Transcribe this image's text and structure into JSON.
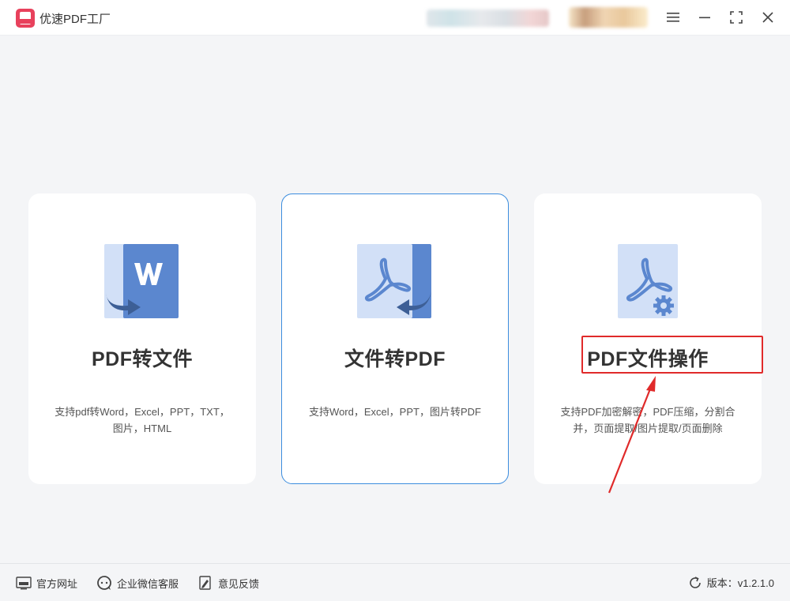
{
  "titlebar": {
    "app_title": "优速PDF工厂",
    "icons": [
      "menu-icon",
      "minimize-icon",
      "maximize-icon",
      "close-icon"
    ]
  },
  "cards": [
    {
      "title": "PDF转文件",
      "desc_line1": "支持pdf转Word，Excel，PPT，TXT，",
      "desc_line2": "图片，HTML",
      "icon": "word-convert-icon"
    },
    {
      "title": "文件转PDF",
      "desc_line1": "支持Word，Excel，PPT，图片转PDF",
      "desc_line2": "",
      "icon": "pdf-convert-icon"
    },
    {
      "title": "PDF文件操作",
      "desc_line1": "支持PDF加密解密，PDF压缩，分割合",
      "desc_line2": "并，页面提取/图片提取/页面删除",
      "icon": "pdf-settings-icon"
    }
  ],
  "footer": {
    "website": "官方网址",
    "wechat_service": "企业微信客服",
    "feedback": "意见反馈",
    "version": "版本：v1.2.1.0"
  },
  "colors": {
    "accent_blue": "#3c8dde",
    "icon_dark_blue": "#5b87cf",
    "icon_light_blue": "#d2e0f7",
    "annotation_red": "#e02a2a",
    "brand_pink": "#e8415c"
  }
}
